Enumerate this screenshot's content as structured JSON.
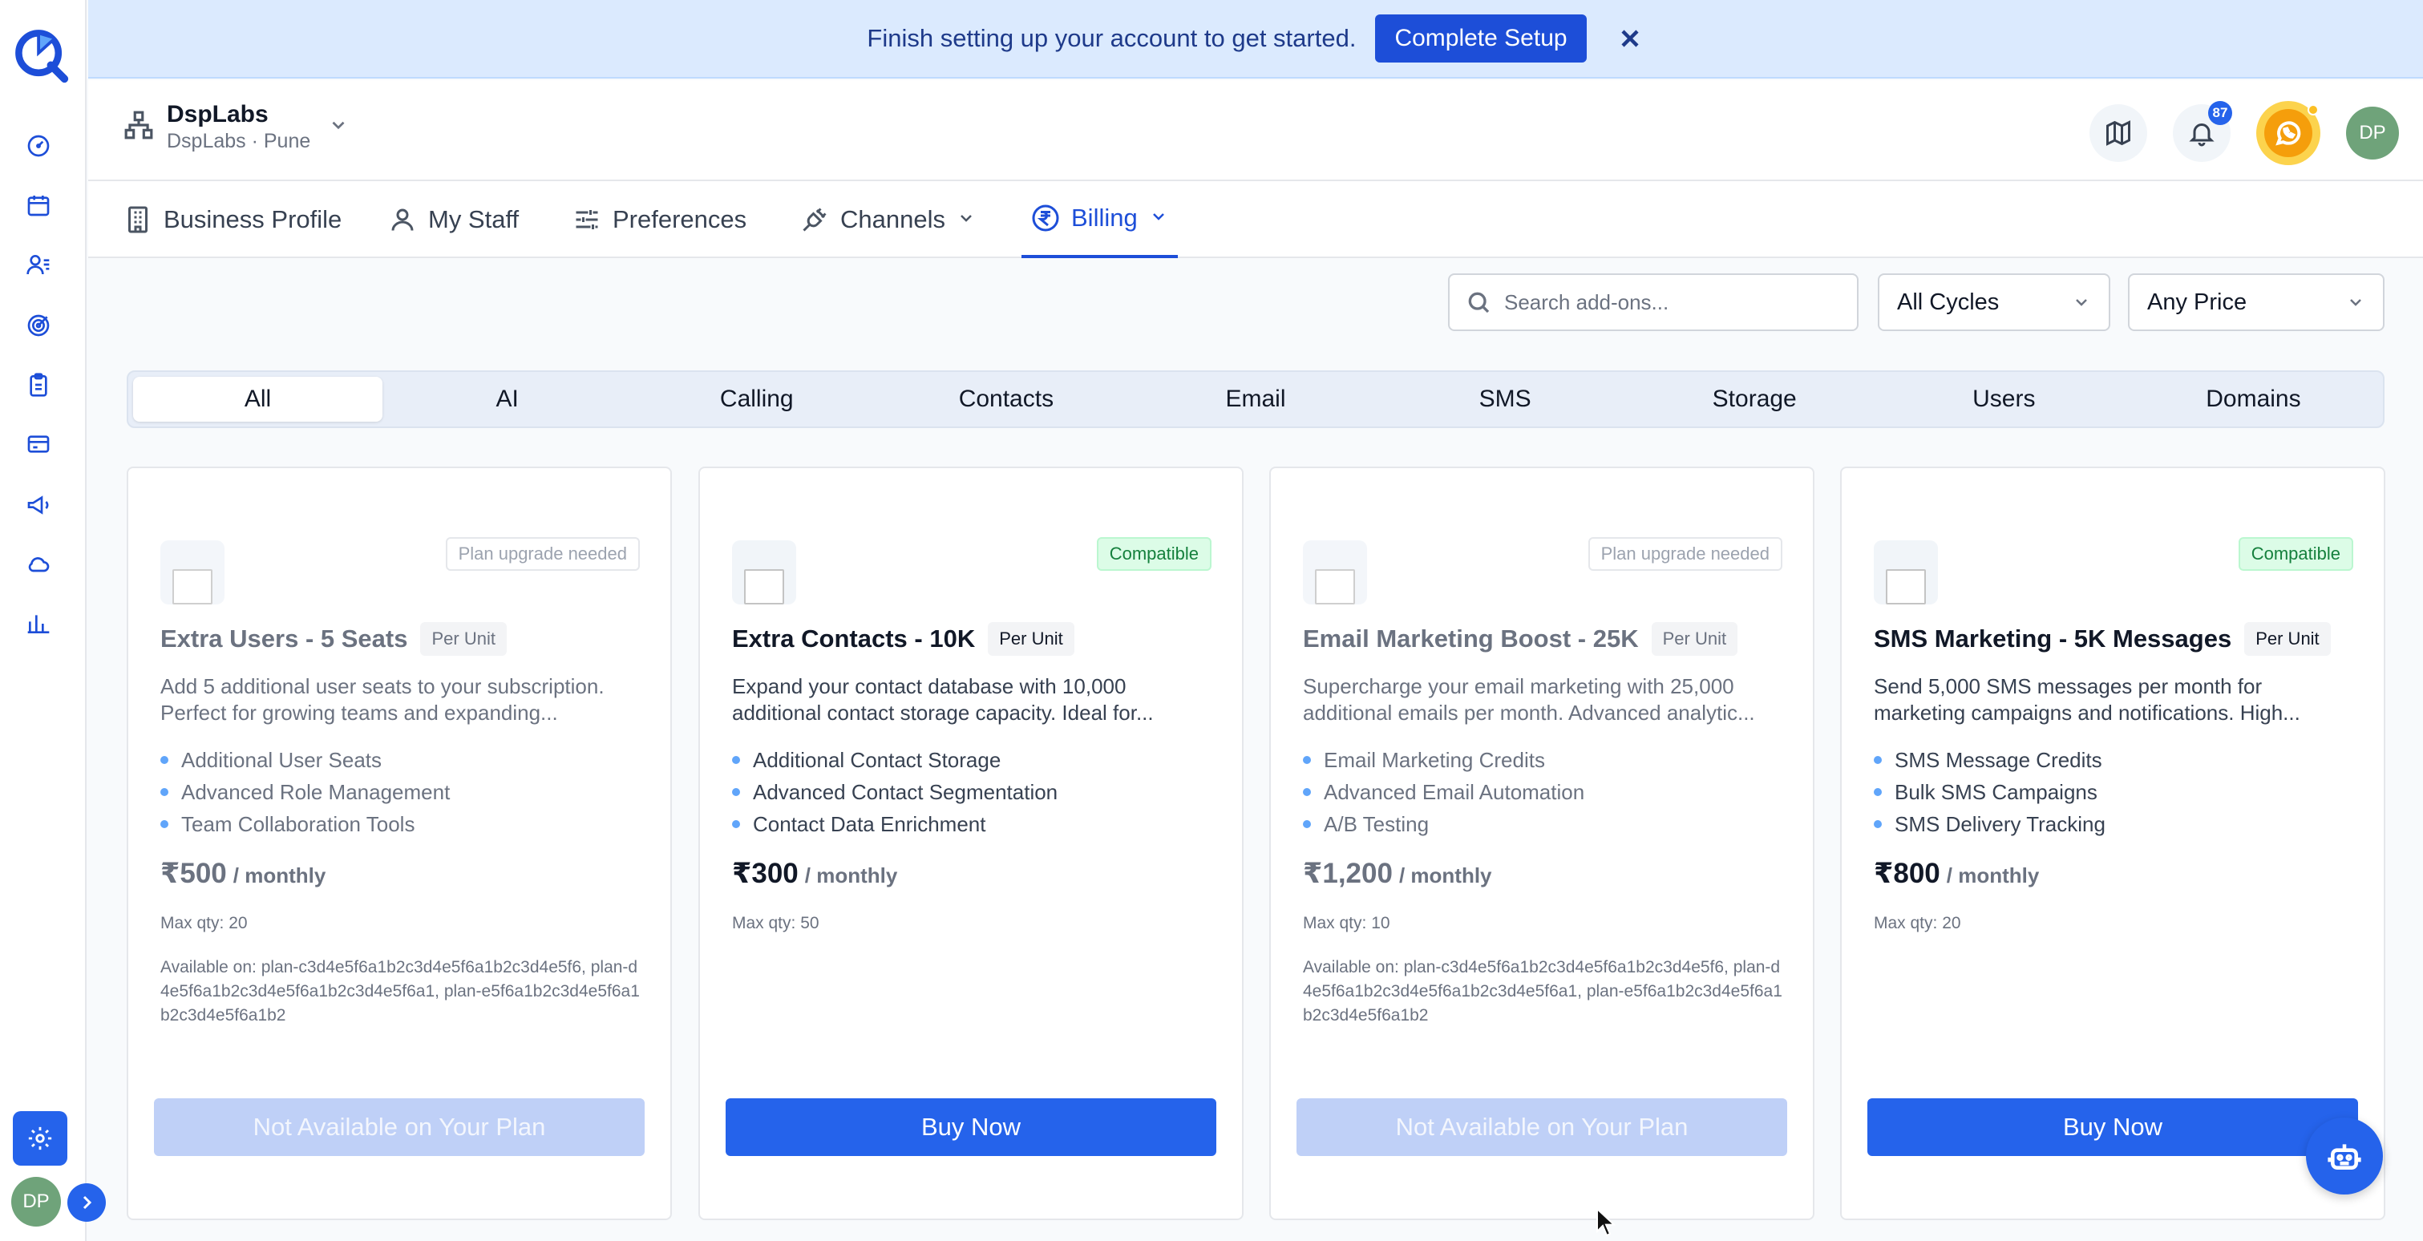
{
  "banner": {
    "text": "Finish setting up your account to get started.",
    "button_label": "Complete Setup"
  },
  "org": {
    "name": "DspLabs",
    "subtitle": "DspLabs · Pune"
  },
  "header": {
    "notification_count": "87",
    "avatar_initials": "DP"
  },
  "rail": {
    "avatar_initials": "DP",
    "items": [
      "dashboard-icon",
      "calendar-icon",
      "contacts-icon",
      "target-icon",
      "clipboard-icon",
      "card-icon",
      "megaphone-icon",
      "cloud-icon",
      "chart-icon"
    ]
  },
  "tabs": [
    {
      "label": "Business Profile",
      "icon": "building-icon"
    },
    {
      "label": "My Staff",
      "icon": "user-icon"
    },
    {
      "label": "Preferences",
      "icon": "sliders-icon"
    },
    {
      "label": "Channels",
      "icon": "plug-icon"
    },
    {
      "label": "Billing",
      "icon": "rupee-icon"
    }
  ],
  "filters": {
    "search_placeholder": "Search add-ons...",
    "cycle": "All Cycles",
    "price": "Any Price"
  },
  "categories": [
    "All",
    "AI",
    "Calling",
    "Contacts",
    "Email",
    "SMS",
    "Storage",
    "Users",
    "Domains"
  ],
  "cards": [
    {
      "title": "Extra Users - 5 Seats",
      "unit": "Per Unit",
      "badge": "Plan upgrade needed",
      "description": "Add 5 additional user seats to your subscription. Perfect for growing teams and expanding...",
      "features": [
        "Additional User Seats",
        "Advanced Role Management",
        "Team Collaboration Tools"
      ],
      "price": "₹500",
      "cycle": "/ monthly",
      "max_qty": "Max qty: 20",
      "available_on": "Available on: plan-c3d4e5f6a1b2c3d4e5f6a1b2c3d4e5f6, plan-d4e5f6a1b2c3d4e5f6a1b2c3d4e5f6a1, plan-e5f6a1b2c3d4e5f6a1b2c3d4e5f6a1b2",
      "cta": "Not Available on Your Plan"
    },
    {
      "title": "Extra Contacts - 10K",
      "unit": "Per Unit",
      "badge": "Compatible",
      "description": "Expand your contact database with 10,000 additional contact storage capacity. Ideal for...",
      "features": [
        "Additional Contact Storage",
        "Advanced Contact Segmentation",
        "Contact Data Enrichment"
      ],
      "price": "₹300",
      "cycle": "/ monthly",
      "max_qty": "Max qty: 50",
      "available_on": "",
      "cta": "Buy Now"
    },
    {
      "title": "Email Marketing Boost - 25K",
      "unit": "Per Unit",
      "badge": "Plan upgrade needed",
      "description": "Supercharge your email marketing with 25,000 additional emails per month. Advanced analytic...",
      "features": [
        "Email Marketing Credits",
        "Advanced Email Automation",
        "A/B Testing"
      ],
      "price": "₹1,200",
      "cycle": "/ monthly",
      "max_qty": "Max qty: 10",
      "available_on": "Available on: plan-c3d4e5f6a1b2c3d4e5f6a1b2c3d4e5f6, plan-d4e5f6a1b2c3d4e5f6a1b2c3d4e5f6a1, plan-e5f6a1b2c3d4e5f6a1b2c3d4e5f6a1b2",
      "cta": "Not Available on Your Plan"
    },
    {
      "title": "SMS Marketing - 5K Messages",
      "unit": "Per Unit",
      "badge": "Compatible",
      "description": "Send 5,000 SMS messages per month for marketing campaigns and notifications. High...",
      "features": [
        "SMS Message Credits",
        "Bulk SMS Campaigns",
        "SMS Delivery Tracking"
      ],
      "price": "₹800",
      "cycle": "/ monthly",
      "max_qty": "Max qty: 20",
      "available_on": "",
      "cta": "Buy Now"
    }
  ]
}
